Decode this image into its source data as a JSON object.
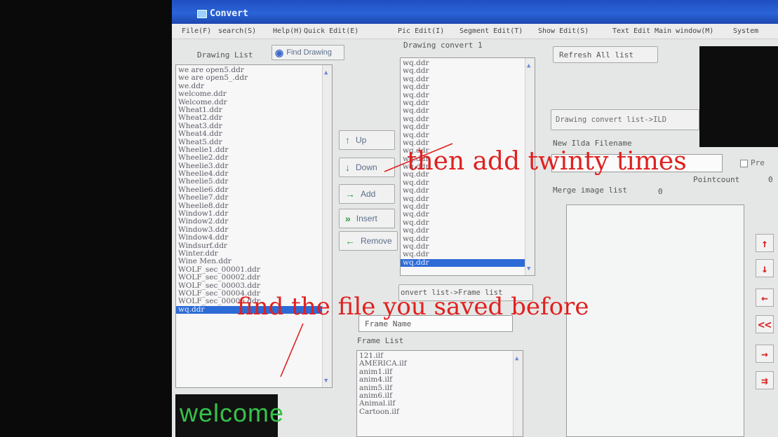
{
  "window": {
    "title": "Convert"
  },
  "menu": [
    "File(F)",
    "search(S)",
    "Help(H)",
    "Quick Edit(E)",
    "Pic Edit(I)",
    "Segment Edit(T)",
    "Show Edit(S)",
    "Text Edit",
    "Main window(M)",
    "System"
  ],
  "drawing_list": {
    "label": "Drawing List",
    "find_button": "Find Drawing",
    "items": [
      "we are open5.ddr",
      "we are open5_.ddr",
      "we.ddr",
      "welcome.ddr",
      "  Welcome.ddr",
      "Wheat1.ddr",
      "Wheat2.ddr",
      "Wheat3.ddr",
      "Wheat4.ddr",
      "Wheat5.ddr",
      "Wheelie1.ddr",
      "Wheelie2.ddr",
      "Wheelie3.ddr",
      "Wheelie4.ddr",
      "Wheelie5.ddr",
      "Wheelie6.ddr",
      "Wheelie7.ddr",
      "Wheelie8.ddr",
      "Window1.ddr",
      "Window2.ddr",
      "Window3.ddr",
      "Window4.ddr",
      "Windsurf.ddr",
      "Winter.ddr",
      "Wine Men.ddr",
      "WOLF_sec_00001.ddr",
      "WOLF_sec_00002.ddr",
      "WOLF_sec_00003.ddr",
      "WOLF_sec_00004.ddr",
      "WOLF_sec_00005.ddr",
      "wq.ddr"
    ],
    "selected_index": 30
  },
  "drawing_convert": {
    "label": "Drawing convert 1",
    "items": [
      "wq.ddr",
      "wq.ddr",
      "wq.ddr",
      "wq.ddr",
      "wq.ddr",
      "wq.ddr",
      "wq.ddr",
      "wq.ddr",
      "wq.ddr",
      "wq.ddr",
      "wq.ddr",
      "wq.ddr",
      "wq.ddr",
      "wq.ddr",
      "wq.ddr",
      "wq.ddr",
      "wq.ddr",
      "wq.ddr",
      "wq.ddr",
      "wq.ddr",
      "wq.ddr",
      "wq.ddr",
      "wq.ddr",
      "wq.ddr",
      "wq.ddr",
      "wq.ddr"
    ],
    "selected_index": 25
  },
  "buttons": {
    "up": "Up",
    "down": "Down",
    "add": "Add",
    "insert": "Insert",
    "remove": "Remove",
    "refresh": "Refresh All list"
  },
  "convert_frame_label": "onvert list->Frame list",
  "frame_name_label": "Frame Name",
  "frame_list": {
    "label": "Frame List",
    "items": [
      "121.ilf",
      "AMERICA.ilf",
      "anim1.ilf",
      "anim4.ilf",
      "anim5.ilf",
      "anim6.ilf",
      "Animal.ilf",
      "Cartoon.ilf"
    ]
  },
  "right_panel": {
    "convert_ild_label": "Drawing convert list->ILD",
    "new_ilda_label": "New Ilda Filename",
    "pre_label": "Pre",
    "pointcount_label": "Pointcount",
    "pointcount_value": "0",
    "merge_label": "Merge image list",
    "merge_count": "0"
  },
  "side_buttons": [
    "↑",
    "↓",
    "←",
    "<<",
    "→",
    "⇉"
  ],
  "welcome_text": "welcome",
  "annotations": {
    "top": "then add twinty times",
    "bottom": "find the file you saved before"
  }
}
